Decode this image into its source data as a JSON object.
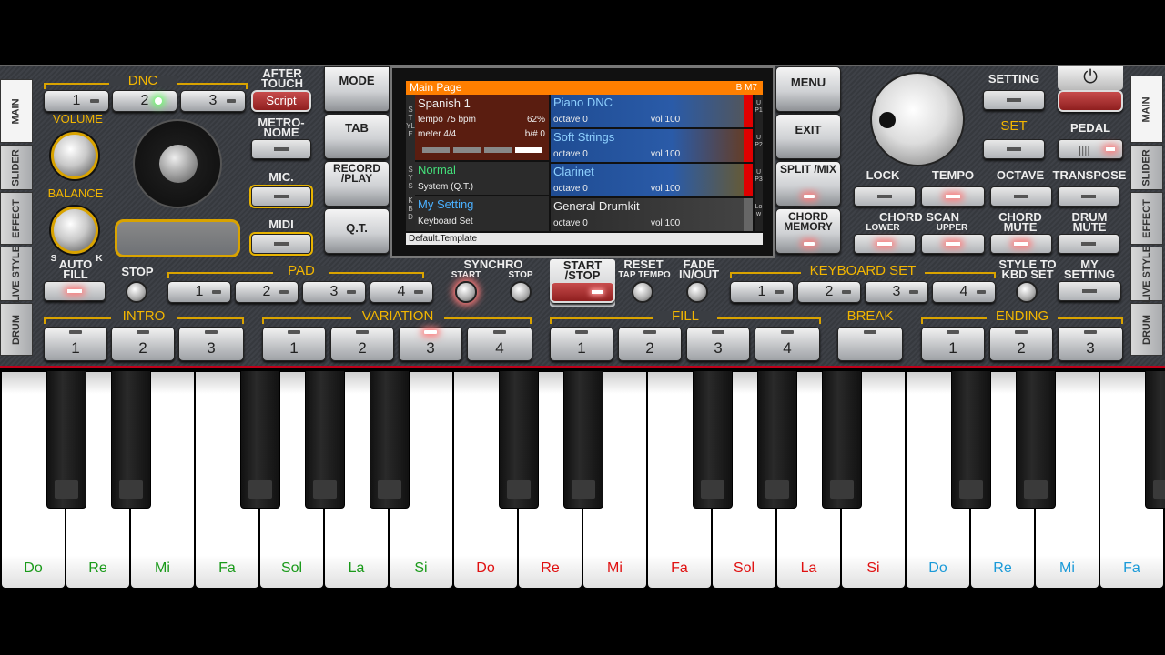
{
  "side_tabs_left": [
    "MAIN",
    "SLIDER",
    "EFFECT",
    "LIVE STYLE",
    "DRUM"
  ],
  "side_tabs_right": [
    "MAIN",
    "SLIDER",
    "EFFECT",
    "LIVE STYLE",
    "DRUM"
  ],
  "dnc": {
    "title": "DNC",
    "buttons": [
      "1",
      "2",
      "3",
      "Script"
    ],
    "active_index": 1
  },
  "after_touch": "AFTER TOUCH",
  "metronome": "METRO- NOME",
  "mic": "MIC.",
  "midi": "MIDI",
  "volume": "VOLUME",
  "balance": "BALANCE",
  "balance_s": "S",
  "balance_k": "K",
  "mode": "MODE",
  "tab": "TAB",
  "record_play": "RECORD /PLAY",
  "qt": "Q.T.",
  "menu": "MENU",
  "exit": "EXIT",
  "split_mix": "SPLIT /MIX",
  "chord_memory": "CHORD MEMORY",
  "setting": "SETTING",
  "set": "SET",
  "pedal": "PEDAL",
  "lock": "LOCK",
  "tempo": "TEMPO",
  "octave": "OCTAVE",
  "transpose": "TRANSPOSE",
  "chord_scan": "CHORD SCAN",
  "lower": "LOWER",
  "upper": "UPPER",
  "chord_mute": "CHORD MUTE",
  "drum_mute": "DRUM MUTE",
  "screen": {
    "page": "Main Page",
    "chord": "B M7",
    "style": {
      "name": "Spanish 1",
      "tempo": "tempo 75 bpm",
      "percent": "62%",
      "meter": "meter 4/4",
      "bsharp": "b/# 0"
    },
    "sys": {
      "name": "Normal",
      "sub": "System (Q.T.)"
    },
    "kbd": {
      "name": "My Setting",
      "sub": "Keyboard Set"
    },
    "left_tags": {
      "style": "STYLE",
      "sys": "SYS",
      "kbd": "KBD"
    },
    "parts": [
      {
        "name": "Piano DNC",
        "octave": "octave 0",
        "vol": "vol 100",
        "tag": "UP1"
      },
      {
        "name": "Soft Strings",
        "octave": "octave 0",
        "vol": "vol 100",
        "tag": "UP2"
      },
      {
        "name": "Clarinet",
        "octave": "octave 0",
        "vol": "vol 100",
        "tag": "UP3"
      },
      {
        "name": "General Drumkit",
        "octave": "octave 0",
        "vol": "vol 100",
        "tag": "Low"
      }
    ],
    "footer": "Default.Template"
  },
  "row3": {
    "auto_fill": "AUTO FILL",
    "stop": "STOP",
    "pad": "PAD",
    "pad_buttons": [
      "1",
      "2",
      "3",
      "4"
    ],
    "synchro": "SYNCHRO",
    "sync_start": "START",
    "sync_stop": "STOP",
    "start_stop": "START /STOP",
    "reset": "RESET",
    "tap_tempo": "TAP TEMPO",
    "fade": "FADE IN/OUT",
    "keyboard_set": "KEYBOARD SET",
    "kbd_buttons": [
      "1",
      "2",
      "3",
      "4"
    ],
    "style_to_kbd": "STYLE TO KBD SET",
    "my_setting": "MY SETTING"
  },
  "row4": {
    "intro": "INTRO",
    "intro_buttons": [
      "1",
      "2",
      "3"
    ],
    "variation": "VARIATION",
    "variation_buttons": [
      "1",
      "2",
      "3",
      "4"
    ],
    "variation_active": 2,
    "fill": "FILL",
    "fill_buttons": [
      "1",
      "2",
      "3",
      "4"
    ],
    "break": "BREAK",
    "ending": "ENDING",
    "ending_buttons": [
      "1",
      "2",
      "3"
    ]
  },
  "keys": [
    {
      "label": "Do",
      "color": "#1a9a1a"
    },
    {
      "label": "Re",
      "color": "#1a9a1a"
    },
    {
      "label": "Mi",
      "color": "#1a9a1a"
    },
    {
      "label": "Fa",
      "color": "#1a9a1a"
    },
    {
      "label": "Sol",
      "color": "#1a9a1a"
    },
    {
      "label": "La",
      "color": "#1a9a1a"
    },
    {
      "label": "Si",
      "color": "#1a9a1a"
    },
    {
      "label": "Do",
      "color": "#e01010"
    },
    {
      "label": "Re",
      "color": "#e01010"
    },
    {
      "label": "Mi",
      "color": "#e01010"
    },
    {
      "label": "Fa",
      "color": "#e01010"
    },
    {
      "label": "Sol",
      "color": "#e01010"
    },
    {
      "label": "La",
      "color": "#e01010"
    },
    {
      "label": "Si",
      "color": "#e01010"
    },
    {
      "label": "Do",
      "color": "#1a9ad8"
    },
    {
      "label": "Re",
      "color": "#1a9ad8"
    },
    {
      "label": "Mi",
      "color": "#1a9ad8"
    },
    {
      "label": "Fa",
      "color": "#1a9ad8"
    }
  ]
}
